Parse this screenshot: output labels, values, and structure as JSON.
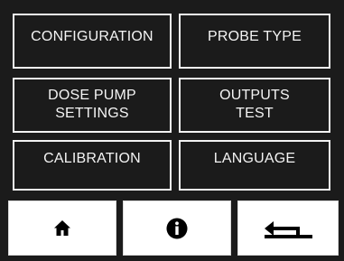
{
  "menu": {
    "configuration": "CONFIGURATION",
    "probe_type": "PROBE TYPE",
    "dose_pump_settings": "DOSE PUMP\nSETTINGS",
    "outputs_test": "OUTPUTS\nTEST",
    "calibration": "CALIBRATION",
    "language": "LANGUAGE"
  },
  "nav": {
    "home_icon": "home-icon",
    "info_icon": "info-icon",
    "back_icon": "return-arrow-icon"
  },
  "colors": {
    "background": "#1b1b1b",
    "button_border": "#f2f2f2",
    "button_text": "#f4f4f4",
    "nav_background": "#ffffff",
    "icon": "#000000"
  }
}
